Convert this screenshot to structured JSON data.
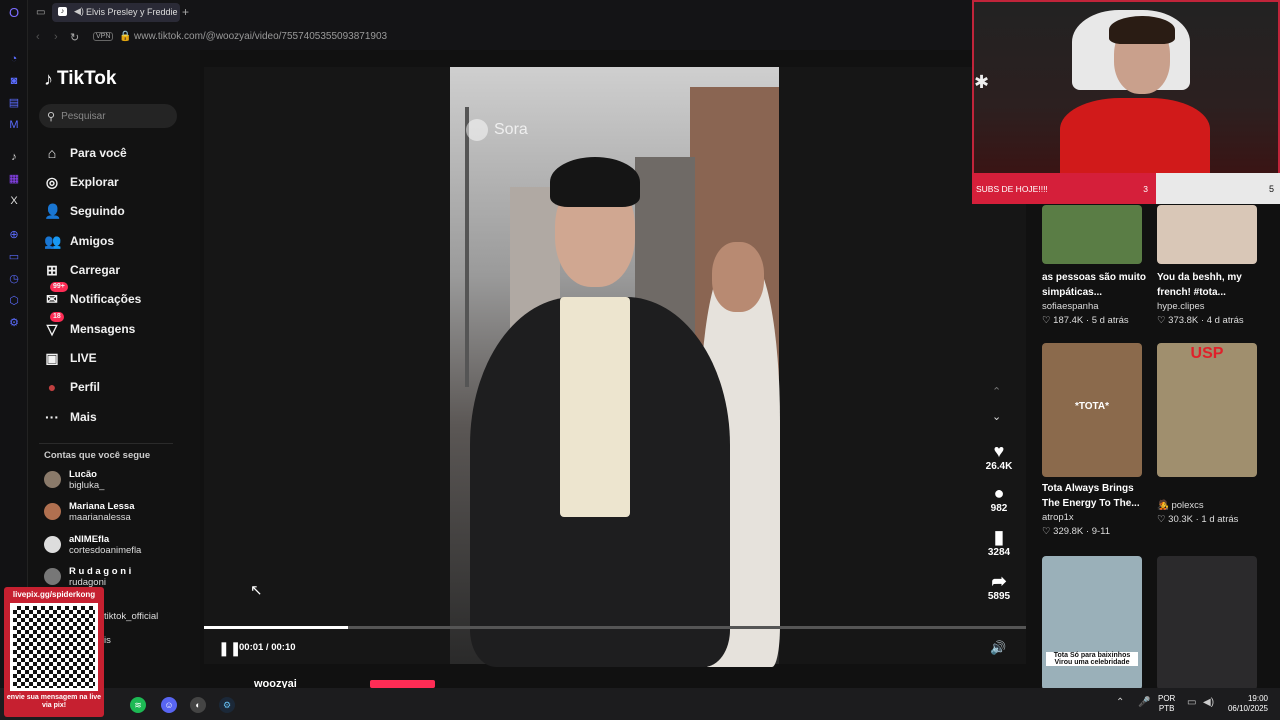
{
  "browser": {
    "tab_title": "Elvis Presley y Freddie",
    "vpn_label": "VPN",
    "url": "www.tiktok.com/@woozyai/video/7557405355093871903"
  },
  "tiktok": {
    "logo": "TikTok",
    "search_placeholder": "Pesquisar",
    "nav": [
      {
        "label": "Para você",
        "icon": "home-icon",
        "glyph": "⌂"
      },
      {
        "label": "Explorar",
        "icon": "compass-icon",
        "glyph": "◎"
      },
      {
        "label": "Seguindo",
        "icon": "following-icon",
        "glyph": "👤"
      },
      {
        "label": "Amigos",
        "icon": "friends-icon",
        "glyph": "👥"
      },
      {
        "label": "Carregar",
        "icon": "upload-icon",
        "glyph": "⊞"
      },
      {
        "label": "Notificações",
        "icon": "notifications-icon",
        "glyph": "✉",
        "badge": "99+"
      },
      {
        "label": "Mensagens",
        "icon": "messages-icon",
        "glyph": "▽",
        "badge": "18"
      },
      {
        "label": "LIVE",
        "icon": "live-icon",
        "glyph": "▣"
      },
      {
        "label": "Perfil",
        "icon": "profile-icon",
        "glyph": "●"
      },
      {
        "label": "Mais",
        "icon": "more-icon",
        "glyph": "···"
      }
    ],
    "following_header": "Contas que você segue",
    "following": [
      {
        "name": "Lucão",
        "user": "bigluka_"
      },
      {
        "name": "Mariana Lessa",
        "user": "maarianalessa"
      },
      {
        "name": "aNIMEfla",
        "user": "cortesdoanimefla"
      },
      {
        "name": "R u d a g o n i",
        "user": "rudagoni"
      }
    ],
    "following_partial": [
      "tiktok_official",
      "is"
    ]
  },
  "player": {
    "watermark": "Sora",
    "time": "00:01 / 00:10",
    "progress": 0.175,
    "author_partial": "woozyai",
    "actions": [
      {
        "icon": "heart-icon",
        "glyph": "♥",
        "count": "26.4K"
      },
      {
        "icon": "comment-icon",
        "glyph": "●",
        "count": "982"
      },
      {
        "icon": "bookmark-icon",
        "glyph": "▮",
        "count": "3284"
      },
      {
        "icon": "share-icon",
        "glyph": "➦",
        "count": "5895"
      }
    ]
  },
  "recommendations": [
    {
      "title": "as pessoas são muito simpáticas...",
      "author": "sofiaespanha",
      "stats": "♡ 187.4K · 5 d atrás",
      "color": "#5a7d45"
    },
    {
      "title": "You da beshh, my french! #tota...",
      "author": "hype.clipes",
      "stats": "♡ 373.8K · 4 d atrás",
      "color": "#d9c7b7"
    },
    {
      "title": "Tota Always Brings The Energy To The...",
      "author": "atrop1x",
      "stats": "♡ 329.8K · 9-11",
      "color": "#8b6a4c",
      "overlay": "*TOTA*"
    },
    {
      "title": "",
      "author": "🧑‍🎤 polexcs",
      "stats": "♡ 30.3K · 1 d atrás",
      "color": "#a08f6e",
      "overlay": "USP"
    },
    {
      "title": "",
      "author": "",
      "stats": "",
      "color": "#9ab0b9",
      "overlay": "Tota Só para baixinhos Virou uma celebridade"
    },
    {
      "title": "",
      "author": "",
      "stats": "",
      "color": "#2b2a2c"
    }
  ],
  "stream": {
    "subs_label": "SUBS DE HOJE!!!!",
    "subs_left": "3",
    "subs_right": "5",
    "qr_top": "livepix.gg/spiderkong",
    "qr_bottom": "envie sua mensagem na live via pix!"
  },
  "taskbar": {
    "lang": "POR",
    "layout": "PTB",
    "time": "19:00",
    "date": "06/10/2025"
  }
}
